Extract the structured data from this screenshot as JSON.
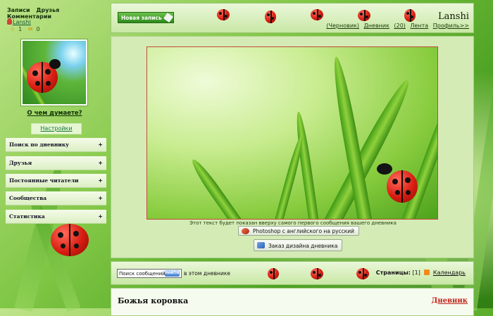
{
  "user_menu": {
    "links": [
      "Записи",
      "Друзья",
      "Комментарии"
    ],
    "username": "Lanshi",
    "counters": [
      "1",
      "0"
    ]
  },
  "status_prompt": "О чем думаете?",
  "settings_label": "Настройки",
  "sidebar_menu": [
    {
      "label": "Поиск по дневнику",
      "toggle": "+"
    },
    {
      "label": "Друзья",
      "toggle": "+"
    },
    {
      "label": "Постоянные читатели",
      "toggle": "+"
    },
    {
      "label": "Сообщества",
      "toggle": "+"
    },
    {
      "label": "Статистика",
      "toggle": "+"
    }
  ],
  "header": {
    "new_post_label": "Новая запись",
    "blog_name": "Lanshi",
    "nav": [
      "(Черновик)",
      "Дневник",
      "(20)",
      "Лента",
      "Профиль>>"
    ]
  },
  "main": {
    "notice_text": "Этот текст будет показан вверху самого первого сообщения вашего дневника",
    "buttons": [
      "Photoshop с английского на русский",
      "Заказ дизайна дневника"
    ]
  },
  "footer_bar": {
    "search_placeholder": "Поиск сообщений",
    "search_button": "НАЙТИ",
    "scope_label": "в этом дневнике",
    "pages_label": "Страницы:",
    "pages_value": "[1]",
    "calendar_label": "Календарь"
  },
  "post": {
    "title": "Божья коровка",
    "diary_link": "Дневник"
  },
  "colors": {
    "accent": "#3a9a1c",
    "link_red": "#c0201a"
  }
}
